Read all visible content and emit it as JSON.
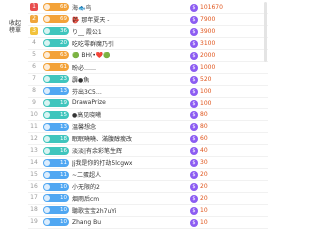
{
  "sidebar": {
    "tab_label_1": "收起",
    "tab_label_2": "榜單"
  },
  "rows": [
    {
      "rank": "1",
      "rank_class": "r1",
      "level": "68",
      "level_color": "orange",
      "name": "海🐟鸟",
      "value": "101670"
    },
    {
      "rank": "2",
      "rank_class": "r2",
      "level": "69",
      "level_color": "orange",
      "name": "👺 那年夏天 -",
      "value": "7900"
    },
    {
      "rank": "3",
      "rank_class": "r3",
      "level": "36",
      "level_color": "teal",
      "name": "り__ 霞公1",
      "value": "3900"
    },
    {
      "rank": "4",
      "rank_class": "rn",
      "level": "20",
      "level_color": "teal",
      "name": "吃吃零群魔乃引",
      "value": "3100"
    },
    {
      "rank": "5",
      "rank_class": "rn",
      "level": "63",
      "level_color": "orange",
      "name": "🟢 BH(•❤️🟢",
      "value": "2000"
    },
    {
      "rank": "6",
      "rank_class": "rn",
      "level": "61",
      "level_color": "orange",
      "name": "盼必……",
      "value": "1000"
    },
    {
      "rank": "7",
      "rank_class": "rn",
      "level": "23",
      "level_color": "teal",
      "name": "霹●魚",
      "value": "520"
    },
    {
      "rank": "8",
      "rank_class": "rn",
      "level": "13",
      "level_color": "blue",
      "name": "芬出3C5…",
      "value": "100"
    },
    {
      "rank": "9",
      "rank_class": "rn",
      "level": "19",
      "level_color": "teal",
      "name": "DrawaPrize",
      "value": "100"
    },
    {
      "rank": "10",
      "rank_class": "rn",
      "level": "15",
      "level_color": "teal",
      "name": "●高见晓曦",
      "value": "80"
    },
    {
      "rank": "11",
      "rank_class": "rn",
      "level": "13",
      "level_color": "blue",
      "name": "温馨想念",
      "value": "80"
    },
    {
      "rank": "12",
      "rank_class": "rn",
      "level": "18",
      "level_color": "teal",
      "name": "眠眠曉曉、滿腹醇瘦改",
      "value": "60"
    },
    {
      "rank": "13",
      "rank_class": "rn",
      "level": "16",
      "level_color": "teal",
      "name": "淡淡|有余彩笔生辉",
      "value": "40"
    },
    {
      "rank": "14",
      "rank_class": "rn",
      "level": "11",
      "level_color": "blue",
      "name": "Jj我是你的打劫5lcgwx",
      "value": "30"
    },
    {
      "rank": "15",
      "rank_class": "rn",
      "level": "11",
      "level_color": "blue",
      "name": "~二蛋超人",
      "value": "20"
    },
    {
      "rank": "16",
      "rank_class": "rn",
      "level": "10",
      "level_color": "blue",
      "name": "小无限的2",
      "value": "20"
    },
    {
      "rank": "17",
      "rank_class": "rn",
      "level": "10",
      "level_color": "blue",
      "name": "烟雨后cm",
      "value": "20"
    },
    {
      "rank": "18",
      "rank_class": "rn",
      "level": "10",
      "level_color": "blue",
      "name": "聽歌宝宝2h7uYi",
      "value": "10"
    },
    {
      "rank": "19",
      "rank_class": "rn",
      "level": "10",
      "level_color": "blue",
      "name": "Zhang Bu",
      "value": "10"
    }
  ],
  "icons": {
    "coin": "currency-coin-icon",
    "coin_glyph": "$"
  },
  "colors": {
    "value": "#e0551c",
    "coin": "#8c5cf2"
  }
}
